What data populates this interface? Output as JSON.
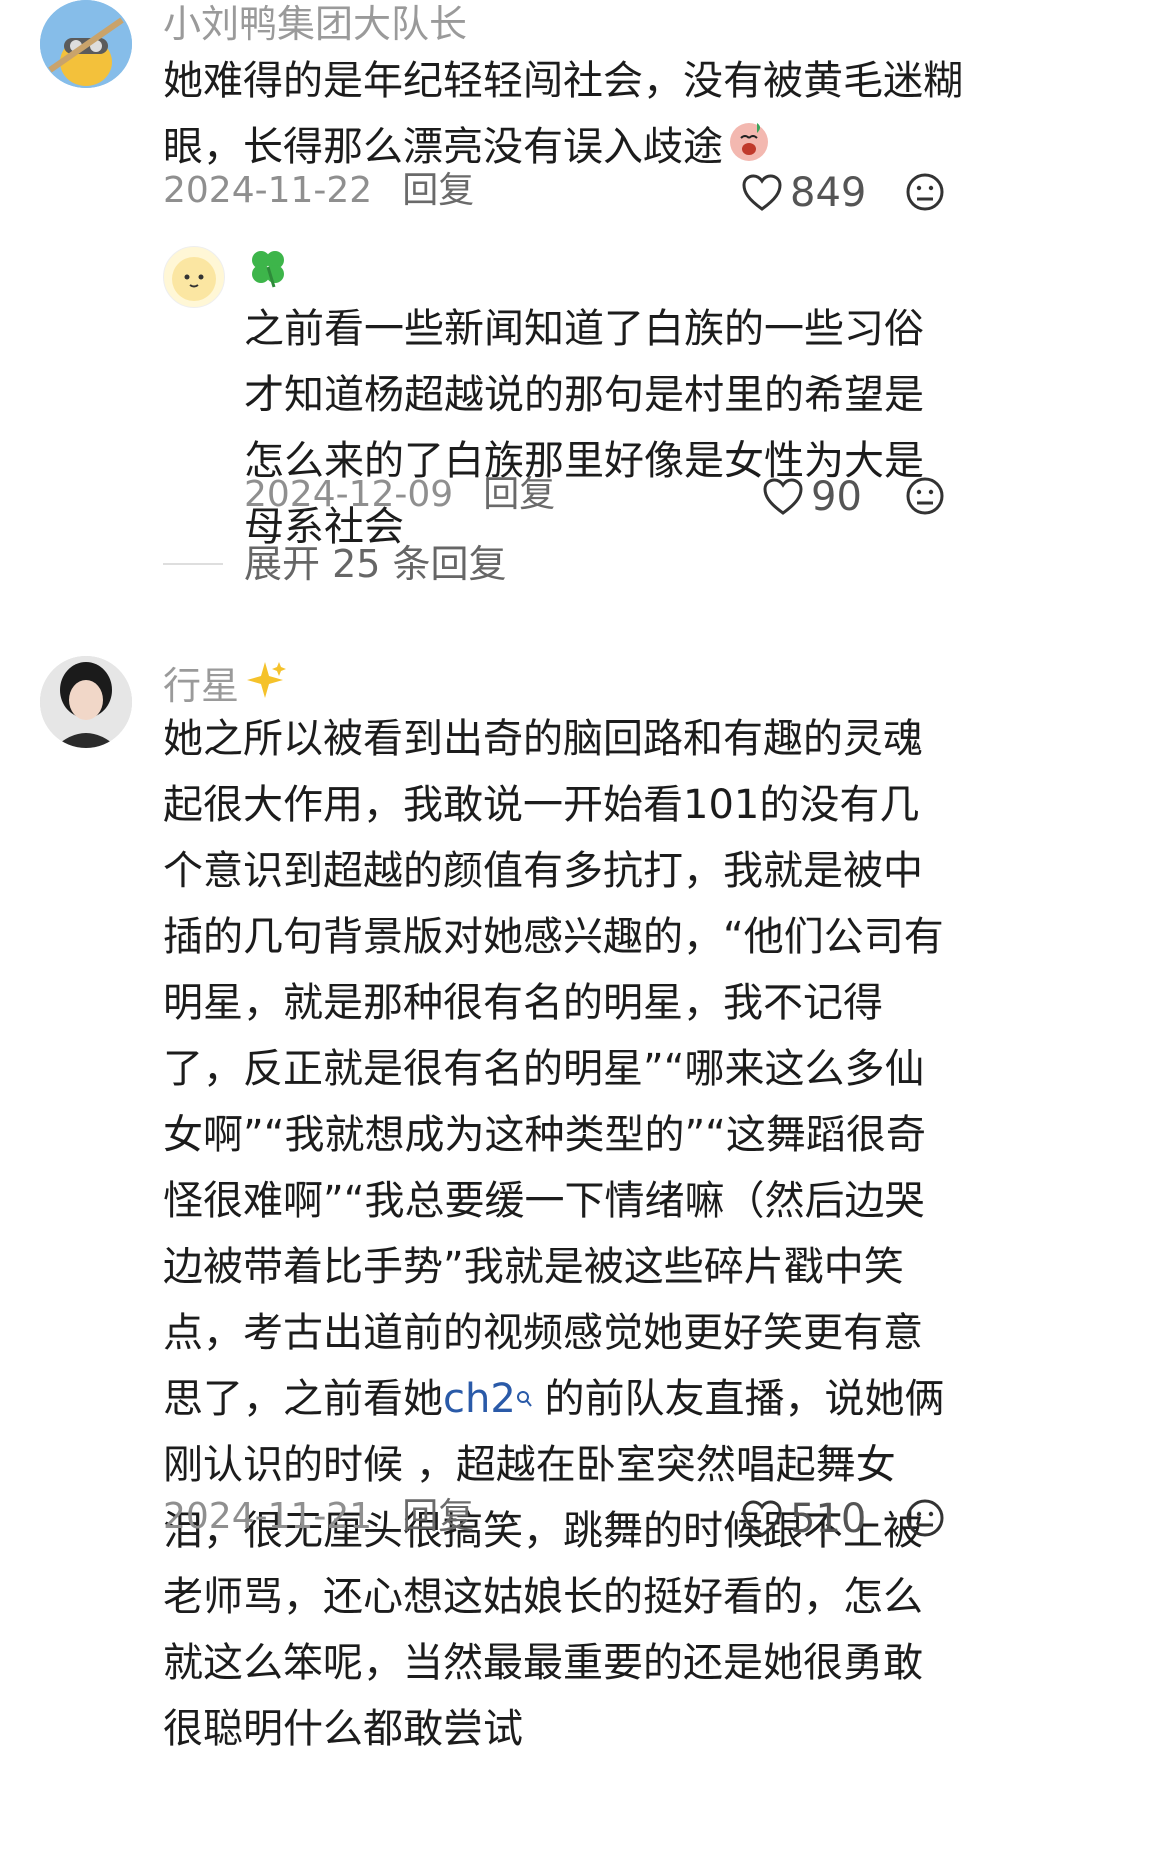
{
  "comments": [
    {
      "username": "小刘鸭集团大队长",
      "text": "她难得的是年纪轻轻闯社会，没有被黄毛迷糊眼，长得那么漂亮没有误入歧途",
      "date": "2024-11-22",
      "reply_label": "回复",
      "likes": "849",
      "replies": [
        {
          "username_icon": "four-leaf-clover",
          "text": "之前看一些新闻知道了白族的一些习俗 才知道杨超越说的那句是村里的希望是怎么来的了白族那里好像是女性为大是母系社会",
          "date": "2024-12-09",
          "reply_label": "回复",
          "likes": "90"
        }
      ],
      "expand_label": "展开 25 条回复"
    },
    {
      "username": "行星",
      "text_before_link": "她之所以被看到出奇的脑回路和有趣的灵魂起很大作用，我敢说一开始看101的没有几个意识到超越的颜值有多抗打，我就是被中插的几句背景版对她感兴趣的，“他们公司有明星，就是那种很有名的明星，我不记得了，反正就是很有名的明星”“哪来这么多仙女啊”“我就想成为这种类型的”“这舞蹈很奇怪很难啊”“我总要缓一下情绪嘛（然后边哭边被带着比手势”我就是被这些碎片戳中笑点，考古出道前的视频感觉她更好笑更有意思了，之前看她",
      "link_text": "ch2",
      "text_after_link": " 的前队友直播，说她俩刚认识的时候 ，超越在卧室突然唱起舞女泪，很无厘头很搞笑，跳舞的时候跟不上被老师骂，还心想这姑娘长的挺好看的，怎么就这么笨呢，当然最最重要的还是她很勇敢很聪明什么都敢尝试",
      "date": "2024-11-21",
      "reply_label": "回复",
      "likes": "510"
    }
  ],
  "colors": {
    "accent_link": "#2a5aa8",
    "muted": "#9a9a9a"
  }
}
